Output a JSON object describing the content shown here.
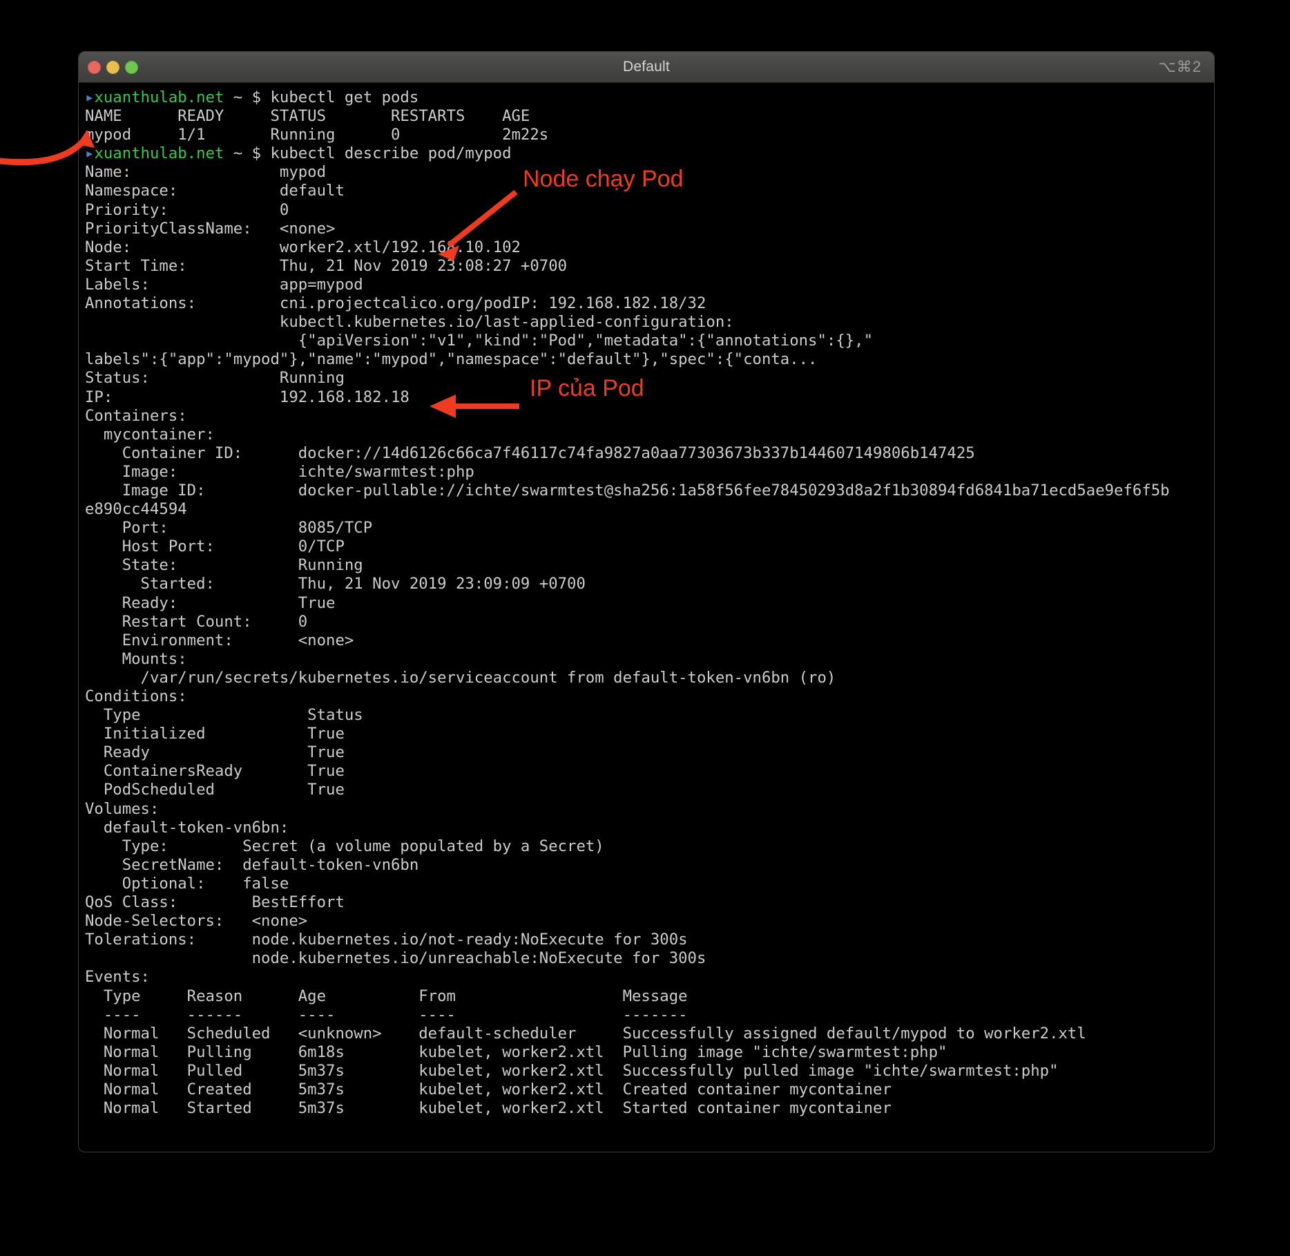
{
  "window": {
    "title": "Default",
    "shortcut": "⌥⌘2",
    "traffic_lights": [
      {
        "name": "close",
        "color": "#e8685f"
      },
      {
        "name": "minimize",
        "color": "#e9c04e"
      },
      {
        "name": "zoom",
        "color": "#6dc750"
      }
    ]
  },
  "theme": {
    "background": "#000000",
    "foreground": "#cccccc",
    "prompt_green": "#35c94a",
    "prompt_marker_blue": "#4e82c4",
    "annotation_red": "#ef3b22",
    "titlebar": "#464644"
  },
  "annotations": [
    {
      "name": "node-annotation",
      "text": "Node chạy Pod"
    },
    {
      "name": "ip-annotation",
      "text": "IP của Pod"
    },
    {
      "name": "pod-name-arrow",
      "text": ""
    }
  ],
  "terminal": {
    "prompt_host": "xuanthulab.net",
    "prompt_path": "~",
    "prompt_symbol": "$",
    "commands": [
      "kubectl get pods",
      "kubectl describe pod/mypod"
    ],
    "get_pods_table": {
      "headers": [
        "NAME",
        "READY",
        "STATUS",
        "RESTARTS",
        "AGE"
      ],
      "rows": [
        [
          "mypod",
          "1/1",
          "Running",
          "0",
          "2m22s"
        ]
      ]
    },
    "describe": {
      "Name": "mypod",
      "Namespace": "default",
      "Priority": "0",
      "PriorityClassName": "<none>",
      "Node": "worker2.xtl/192.168.10.102",
      "Start Time": "Thu, 21 Nov 2019 23:08:27 +0700",
      "Labels": "app=mypod",
      "Annotations": [
        "cni.projectcalico.org/podIP: 192.168.182.18/32",
        "kubectl.kubernetes.io/last-applied-configuration:",
        "{\"apiVersion\":\"v1\",\"kind\":\"Pod\",\"metadata\":{\"annotations\":{},\"labels\":{\"app\":\"mypod\"},\"name\":\"mypod\",\"namespace\":\"default\"},\"spec\":{\"conta..."
      ],
      "Status": "Running",
      "IP": "192.168.182.18"
    },
    "containers": {
      "section_label": "Containers:",
      "name": "mycontainer:",
      "Container ID": "docker://14d6126c66ca7f46117c74fa9827a0aa77303673b337b144607149806b147425",
      "Image": "ichte/swarmtest:php",
      "Image ID": "docker-pullable://ichte/swarmtest@sha256:1a58f56fee78450293d8a2f1b30894fd6841ba71ecd5ae9ef6f5be890cc44594",
      "Port": "8085/TCP",
      "Host Port": "0/TCP",
      "State": "Running",
      "Started": "Thu, 21 Nov 2019 23:09:09 +0700",
      "Ready": "True",
      "Restart Count": "0",
      "Environment": "<none>",
      "Mounts": "/var/run/secrets/kubernetes.io/serviceaccount from default-token-vn6bn (ro)"
    },
    "conditions": {
      "section_label": "Conditions:",
      "headers": [
        "Type",
        "Status"
      ],
      "rows": [
        [
          "Initialized",
          "True"
        ],
        [
          "Ready",
          "True"
        ],
        [
          "ContainersReady",
          "True"
        ],
        [
          "PodScheduled",
          "True"
        ]
      ]
    },
    "volumes": {
      "section_label": "Volumes:",
      "name": "default-token-vn6bn:",
      "Type": "Secret (a volume populated by a Secret)",
      "SecretName": "default-token-vn6bn",
      "Optional": "false"
    },
    "footer": {
      "QoS Class": "BestEffort",
      "Node-Selectors": "<none>",
      "Tolerations": [
        "node.kubernetes.io/not-ready:NoExecute for 300s",
        "node.kubernetes.io/unreachable:NoExecute for 300s"
      ]
    },
    "events": {
      "section_label": "Events:",
      "headers": [
        "Type",
        "Reason",
        "Age",
        "From",
        "Message"
      ],
      "separators": [
        "----",
        "------",
        "----",
        "----",
        "-------"
      ],
      "rows": [
        [
          "Normal",
          "Scheduled",
          "<unknown>",
          "default-scheduler",
          "Successfully assigned default/mypod to worker2.xtl"
        ],
        [
          "Normal",
          "Pulling",
          "6m18s",
          "kubelet, worker2.xtl",
          "Pulling image \"ichte/swarmtest:php\""
        ],
        [
          "Normal",
          "Pulled",
          "5m37s",
          "kubelet, worker2.xtl",
          "Successfully pulled image \"ichte/swarmtest:php\""
        ],
        [
          "Normal",
          "Created",
          "5m37s",
          "kubelet, worker2.xtl",
          "Created container mycontainer"
        ],
        [
          "Normal",
          "Started",
          "5m37s",
          "kubelet, worker2.xtl",
          "Started container mycontainer"
        ]
      ]
    }
  }
}
